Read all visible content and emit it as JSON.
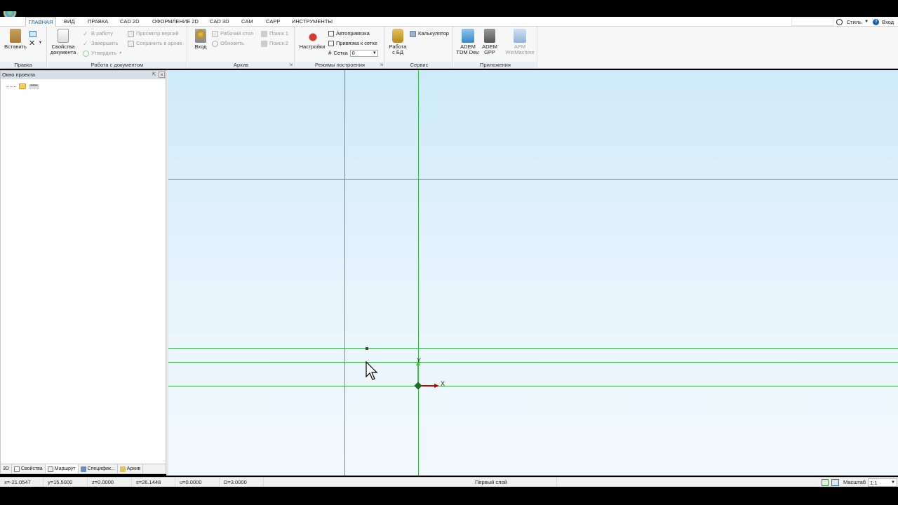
{
  "tabs": [
    "ГЛАВНАЯ",
    "ВИД",
    "ПРАВКА",
    "CAD 2D",
    "ОФОРМЛЕНИЕ 2D",
    "CAD 3D",
    "CAM",
    "CAPP",
    "ИНСТРУМЕНТЫ"
  ],
  "right_tools": {
    "style": "Стиль",
    "login": "Вход"
  },
  "ribbon": {
    "pravka": {
      "label": "Правка",
      "paste": "Вставить"
    },
    "document": {
      "label": "Работа с документом",
      "properties": "Свойства документа",
      "to_work": "В работу",
      "finish": "Завершить",
      "approve": "Утвердить",
      "view_versions": "Просмотр версий",
      "save_to_archive": "Сохранить в архив"
    },
    "archive": {
      "label": "Архив",
      "login": "Вход",
      "desktop": "Рабочий стол",
      "refresh": "Обновить",
      "search1": "Поиск 1",
      "search2": "Поиск 2"
    },
    "modes": {
      "label": "Режимы построения",
      "settings": "Настройки",
      "autosnap": "Автопривязка",
      "grid_snap": "Привязка к сетке",
      "grid": "Сетка",
      "grid_value": "0"
    },
    "service": {
      "label": "Сервис",
      "db_work": "Работа с БД",
      "calculator": "Калькулятор"
    },
    "apps": {
      "label": "Приложения",
      "tdm": "ADEM TDM Dev.",
      "gpp": "ADEM GPP",
      "apm": "APM WinMachine"
    }
  },
  "panel": {
    "title": "Окно проекта",
    "tree_item": "****",
    "tabs": [
      "3D",
      "Свойства",
      "Маршрут",
      "Специфик...",
      "Архив"
    ]
  },
  "viewport": {
    "axis_x": "X",
    "axis_y": "Y"
  },
  "status": {
    "x": "x=-21.0547",
    "y": "y=15.5000",
    "z": "z=0.0000",
    "s": "s=26.1448",
    "u": "u=0.0000",
    "d": "D=3.0000",
    "layer": "Первый слой",
    "scale_label": "Масштаб",
    "scale_value": "1:1"
  },
  "colors": {
    "grid": "#39b54a",
    "axis_x": "#c00000",
    "axis_y": "#39c83a",
    "accent": "#1d5fa8"
  }
}
